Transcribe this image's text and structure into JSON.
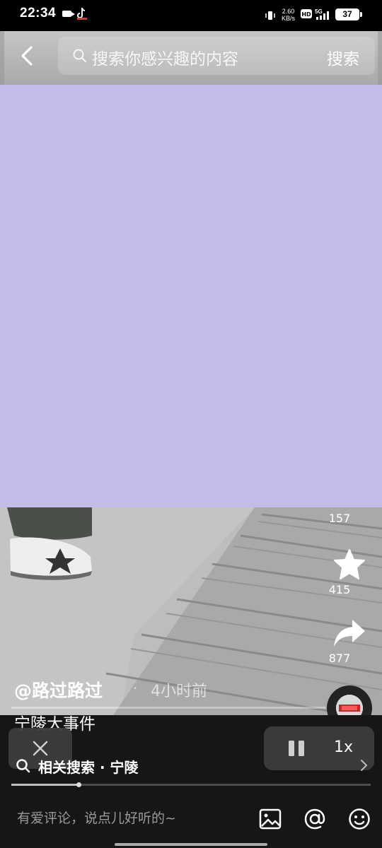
{
  "status_bar": {
    "time": "22:34",
    "network_speed_value": "2.60",
    "network_speed_unit": "KB/s",
    "hd_badge": "HD",
    "network_type": "5G",
    "battery": "37"
  },
  "search_bar": {
    "placeholder": "搜索你感兴趣的内容",
    "search_button": "搜索"
  },
  "side_actions": {
    "comments_count": "157",
    "favorites_count": "415",
    "shares_count": "877"
  },
  "video_info": {
    "author": "@路过路过",
    "separator": "·",
    "time_ago": "4小时前",
    "title": "宁陵大事件"
  },
  "player": {
    "speed_label": "1x"
  },
  "related_search": {
    "label": "相关搜索 · 宁陵"
  },
  "comment_bar": {
    "placeholder": "有爱评论，说点儿好听的~"
  },
  "colors": {
    "overlay": "#c5bbe9",
    "background": "#161616"
  }
}
